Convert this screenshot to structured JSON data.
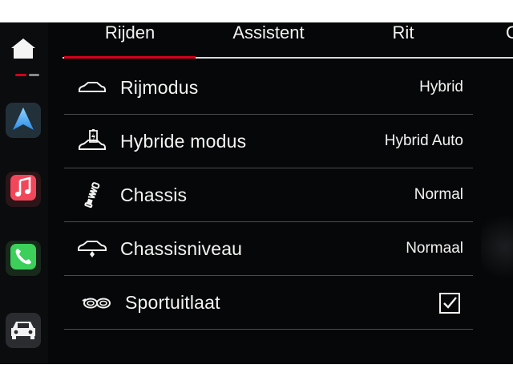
{
  "dock": {
    "items": [
      {
        "name": "home",
        "icon": "home-icon"
      },
      {
        "name": "maps",
        "icon": "navigation-arrow-icon"
      },
      {
        "name": "music",
        "icon": "music-note-icon"
      },
      {
        "name": "phone",
        "icon": "phone-icon"
      },
      {
        "name": "car",
        "icon": "car-icon"
      }
    ]
  },
  "tabs": [
    {
      "label": "Rijden",
      "active": true
    },
    {
      "label": "Assistent",
      "active": false
    },
    {
      "label": "Rit",
      "active": false
    },
    {
      "label": "C",
      "active": false
    }
  ],
  "settings": {
    "rows": [
      {
        "label": "Rijmodus",
        "value": "Hybrid",
        "icon": "car-outline-icon"
      },
      {
        "label": "Hybride modus",
        "value": "Hybrid Auto",
        "icon": "hybrid-battery-car-icon"
      },
      {
        "label": "Chassis",
        "value": "Normal",
        "icon": "shock-absorber-icon"
      },
      {
        "label": "Chassisniveau",
        "value": "Normaal",
        "icon": "car-ride-height-icon"
      },
      {
        "label": "Sportuitlaat",
        "checked": true,
        "icon": "exhaust-pipes-icon"
      }
    ]
  },
  "colors": {
    "accent": "#d5001c",
    "background": "#060708",
    "text": "#f2f2f2",
    "divider": "#4a4c50"
  }
}
